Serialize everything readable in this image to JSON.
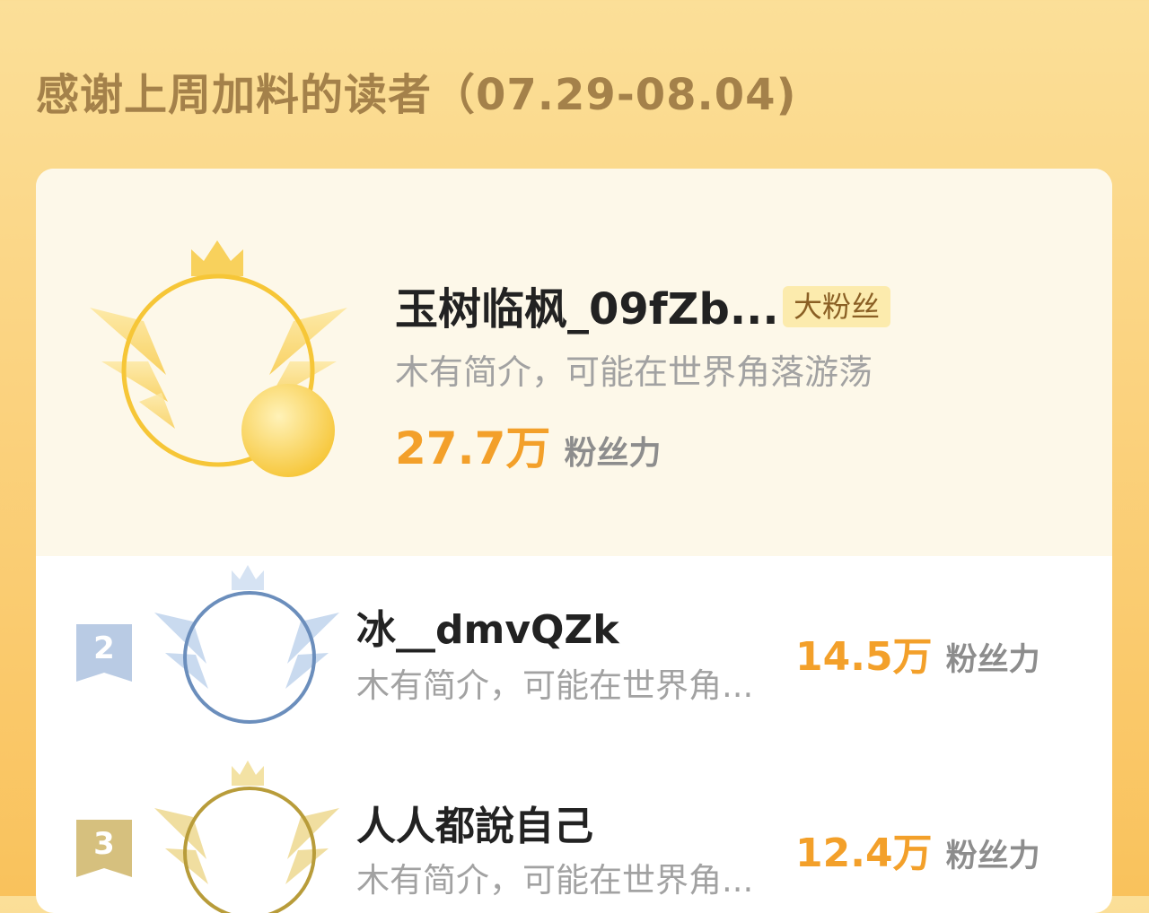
{
  "page": {
    "title": "感谢上周加料的读者（07.29-08.04)"
  },
  "colors": {
    "background": "#fbd27e",
    "title": "#a4814a",
    "fan_power_number": "#f3a02a",
    "badge_bg": "#fcebad",
    "gold": "#f6c637",
    "silver": "#6b8ebc",
    "bronze": "#b89c3a"
  },
  "top_reader": {
    "rank": "1",
    "name": "玉树临枫_09fZb...",
    "badge": "大粉丝",
    "bio": "木有简介，可能在世界角落游荡",
    "fan_power_value": "27.7万",
    "fan_power_label": "粉丝力",
    "frame_icon": "gold-crown-wings-frame-icon"
  },
  "readers": [
    {
      "rank": "2",
      "name": "冰__dmvQZk",
      "bio": "木有简介，可能在世界角...",
      "fan_power_value": "14.5万",
      "fan_power_label": "粉丝力",
      "frame_icon": "silver-crown-wings-frame-icon"
    },
    {
      "rank": "3",
      "name": "人人都說自己",
      "bio": "木有简介，可能在世界角...",
      "fan_power_value": "12.4万",
      "fan_power_label": "粉丝力",
      "frame_icon": "bronze-crown-wings-frame-icon"
    }
  ]
}
